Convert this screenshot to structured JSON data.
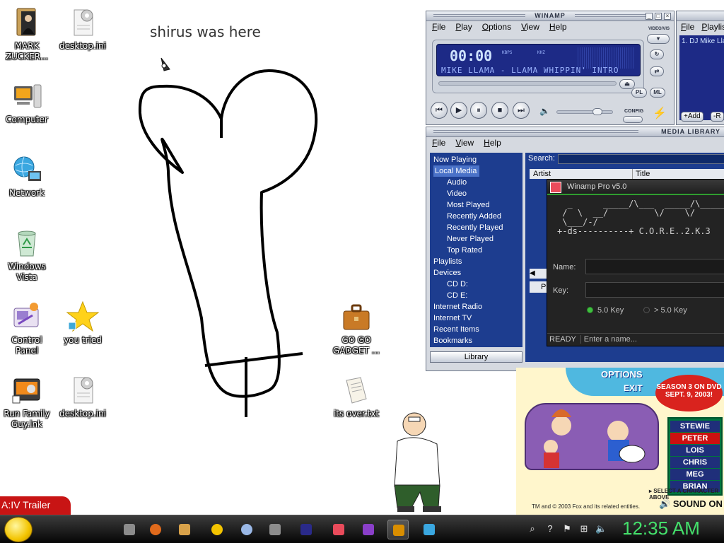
{
  "desktop": {
    "icons": [
      {
        "label": "MARK ZUCKER...",
        "icon": "book-person-icon"
      },
      {
        "label": "desktop.ini",
        "icon": "settings-file-icon"
      },
      {
        "label": "Computer",
        "icon": "computer-icon"
      },
      {
        "label": "Network",
        "icon": "network-globe-icon"
      },
      {
        "label": "Windows Vista",
        "icon": "recycle-bin-icon"
      },
      {
        "label": "Control Panel",
        "icon": "control-panel-icon"
      },
      {
        "label": "you tried",
        "icon": "star-icon"
      },
      {
        "label": "Run Family Guy.lnk",
        "icon": "shortcut-icon"
      },
      {
        "label": "desktop.ini",
        "icon": "settings-file-icon"
      },
      {
        "label": "GO GO GADGET ...",
        "icon": "briefcase-icon"
      },
      {
        "label": "its over.txt",
        "icon": "text-file-icon"
      }
    ],
    "scribble_text": "shirus was here"
  },
  "winamp": {
    "title": "WINAMP",
    "menu": [
      "File",
      "Play",
      "Options",
      "View",
      "Help"
    ],
    "time": "00:00",
    "kbps": "KBPS",
    "khz": "KHZ",
    "ticker": "MIKE LLAMA - LLAMA WHIPPIN' INTRO",
    "side_label": "VIDEO/VIS",
    "config_label": "CONFIG",
    "pl_button": "PL",
    "ml_button": "ML"
  },
  "playlist": {
    "menu": [
      "File",
      "Playlis"
    ],
    "items": [
      "1. DJ Mike Lla"
    ],
    "add_button": "+Add",
    "rem_button": "-R"
  },
  "media_library": {
    "title": "MEDIA LIBRARY",
    "menu": [
      "File",
      "View",
      "Help"
    ],
    "tree": [
      {
        "label": "Now Playing",
        "sub": false,
        "selected": false
      },
      {
        "label": "Local Media",
        "sub": false,
        "selected": true
      },
      {
        "label": "Audio",
        "sub": true,
        "selected": false
      },
      {
        "label": "Video",
        "sub": true,
        "selected": false
      },
      {
        "label": "Most Played",
        "sub": true,
        "selected": false
      },
      {
        "label": "Recently Added",
        "sub": true,
        "selected": false
      },
      {
        "label": "Recently Played",
        "sub": true,
        "selected": false
      },
      {
        "label": "Never Played",
        "sub": true,
        "selected": false
      },
      {
        "label": "Top Rated",
        "sub": true,
        "selected": false
      },
      {
        "label": "Playlists",
        "sub": false,
        "selected": false
      },
      {
        "label": "Devices",
        "sub": false,
        "selected": false
      },
      {
        "label": "CD D:",
        "sub": true,
        "selected": false
      },
      {
        "label": "CD E:",
        "sub": true,
        "selected": false
      },
      {
        "label": "Internet Radio",
        "sub": false,
        "selected": false
      },
      {
        "label": "Internet TV",
        "sub": false,
        "selected": false
      },
      {
        "label": "Recent Items",
        "sub": false,
        "selected": false
      },
      {
        "label": "Bookmarks",
        "sub": false,
        "selected": false
      }
    ],
    "library_button": "Library",
    "search_label": "Search:",
    "columns": [
      "Artist",
      "Title"
    ],
    "play_button": "Pl"
  },
  "pro_dialog": {
    "title": "Winamp Pro v5.0",
    "ascii": "  _      _____/\\___  _____/\\_____\n /  \\  __/         \\/    \\/      \\ \n \\___/-/                          \\/\n+-ds----------+ C.O.R.E..2.K.3",
    "name_label": "Name:",
    "key_label": "Key:",
    "radio_1": "5.0 Key",
    "radio_2": "> 5.0 Key",
    "status_ready": "READY",
    "status_prompt": "Enter a name..."
  },
  "family_guy": {
    "top_left": "OPTIONS",
    "exit": "EXIT",
    "season": "SEASON 3 ON DVD SEPT. 9, 2003!",
    "characters": [
      "STEWIE",
      "PETER",
      "LOIS",
      "CHRIS",
      "MEG",
      "BRIAN"
    ],
    "selected": "PETER",
    "select_hint": "▸ SELECT A CHARACTER ABOVE",
    "copyright": "TM and © 2003 Fox and its related entities.",
    "sound": "SOUND ON"
  },
  "trailer": "A:IV Trailer",
  "taskbar": {
    "clock": "12:35 AM"
  },
  "colors": {
    "winamp_panel": "#d5d9e0",
    "lcd_blue": "#1d2a86",
    "ml_blue": "#1d3d8f",
    "clock_green": "#44e06b",
    "trailer_red": "#c81414"
  }
}
